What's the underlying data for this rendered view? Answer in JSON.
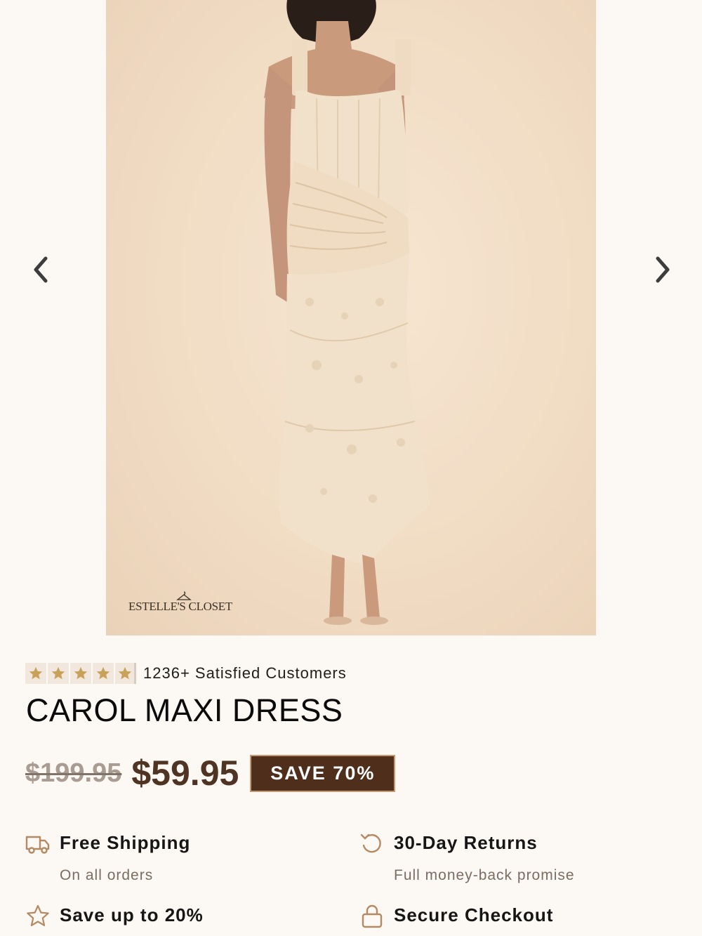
{
  "gallery": {
    "image_alt": "Model wearing cream lace maxi dress",
    "brand_mark": "ESTELLE'S CLOSET",
    "prev_icon": "chevron-left-icon",
    "next_icon": "chevron-right-icon"
  },
  "rating": {
    "stars": 5,
    "text": "1236+ Satisfied Customers",
    "star_color": "#c9a25a"
  },
  "product": {
    "title": "CAROL MAXI DRESS",
    "old_price": "$199.95",
    "price": "$59.95",
    "save_badge": "SAVE 70%"
  },
  "features": [
    {
      "icon": "truck-icon",
      "title": "Free Shipping",
      "subtitle": "On all orders"
    },
    {
      "icon": "return-arrow-icon",
      "title": "30-Day Returns",
      "subtitle": "Full money-back promise"
    },
    {
      "icon": "star-outline-icon",
      "title": "Save up to 20%",
      "subtitle": ""
    },
    {
      "icon": "lock-icon",
      "title": "Secure Checkout",
      "subtitle": ""
    }
  ],
  "colors": {
    "background": "#fcf8f3",
    "accent_brown": "#4f2e1b",
    "price_brown": "#4f3424",
    "icon_tan": "#b58a63"
  }
}
